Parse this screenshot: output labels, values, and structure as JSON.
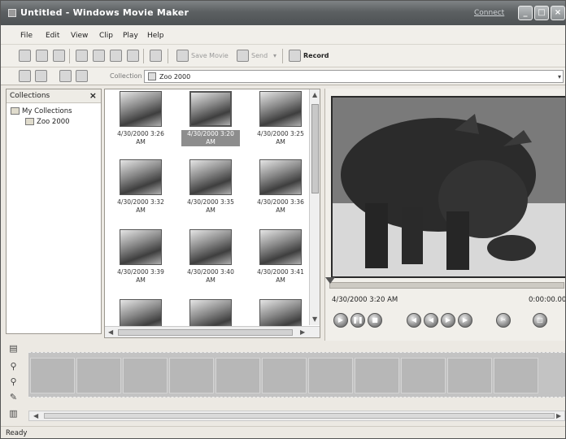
{
  "window": {
    "title": "Untitled - Windows Movie Maker",
    "connect_link": "Connect"
  },
  "menu": [
    "File",
    "Edit",
    "View",
    "Clip",
    "Play",
    "Help"
  ],
  "toolbar": {
    "save_movie_label": "Save Movie",
    "send_label": "Send",
    "record_label": "Record"
  },
  "collection_bar": {
    "label": "Collection",
    "value": "Zoo 2000"
  },
  "collections_pane": {
    "title": "Collections",
    "close_glyph": "×",
    "items": [
      {
        "label": "My Collections"
      },
      {
        "label": "Zoo 2000"
      }
    ]
  },
  "clips": [
    {
      "line1": "4/30/2000 3:26",
      "line2": "AM",
      "selected": false
    },
    {
      "line1": "4/30/2000 3:20",
      "line2": "AM",
      "selected": true
    },
    {
      "line1": "4/30/2000 3:25",
      "line2": "AM",
      "selected": false
    },
    {
      "line1": "4/30/2000 3:32",
      "line2": "AM",
      "selected": false
    },
    {
      "line1": "4/30/2000 3:35",
      "line2": "AM",
      "selected": false
    },
    {
      "line1": "4/30/2000 3:36",
      "line2": "AM",
      "selected": false
    },
    {
      "line1": "4/30/2000 3:39",
      "line2": "AM",
      "selected": false
    },
    {
      "line1": "4/30/2000 3:40",
      "line2": "AM",
      "selected": false
    },
    {
      "line1": "4/30/2000 3:41",
      "line2": "AM",
      "selected": false
    }
  ],
  "monitor": {
    "clip_name": "4/30/2000 3:20 AM",
    "time": "0:00:00.00"
  },
  "status": "Ready"
}
